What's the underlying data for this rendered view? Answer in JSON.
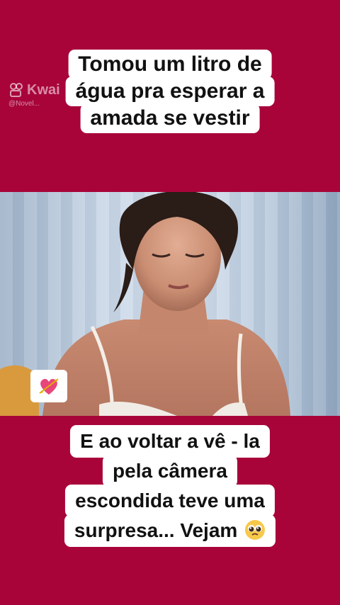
{
  "watermark": {
    "brand": "Kwai",
    "handle": "@Novel..."
  },
  "top_caption": {
    "lines": [
      "Tomou um litro de",
      "água pra esperar a",
      "amada se vestir"
    ]
  },
  "bottom_caption": {
    "lines": [
      "E ao voltar a vê - la",
      "pela câmera",
      "escondida teve uma",
      "surpresa... Vejam"
    ]
  },
  "icons": {
    "sticker": "heart-arrow-icon",
    "emoji": "pleading-face-icon"
  },
  "colors": {
    "background": "#a8043a",
    "caption_bg": "#ffffff",
    "caption_text": "#111111"
  }
}
